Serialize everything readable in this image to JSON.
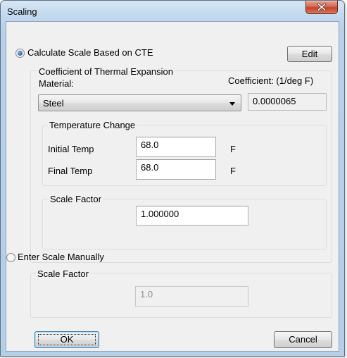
{
  "window": {
    "title": "Scaling"
  },
  "cte_option": {
    "label": "Calculate Scale Based on CTE",
    "selected": true,
    "edit_label": "Edit"
  },
  "cte_group": {
    "title": "Coefficient of Thermal Expansion",
    "material_label": "Material:",
    "coefficient_label": "Coefficient: (1/deg F)",
    "material_value": "Steel",
    "coefficient_value": "0.0000065"
  },
  "temperature": {
    "title": "Temperature Change",
    "initial_label": "Initial Temp",
    "initial_value": "68.0",
    "initial_unit": "F",
    "final_label": "Final Temp",
    "final_value": "68.0",
    "final_unit": "F"
  },
  "scale_factor": {
    "title": "Scale Factor",
    "value": "1.000000"
  },
  "manual_option": {
    "label": "Enter Scale Manually",
    "selected": false
  },
  "manual_scale": {
    "title": "Scale Factor",
    "value": "1.0"
  },
  "footer": {
    "ok_label": "OK",
    "cancel_label": "Cancel"
  },
  "icons": {
    "close": "close-icon",
    "dropdown": "chevron-down-icon"
  }
}
